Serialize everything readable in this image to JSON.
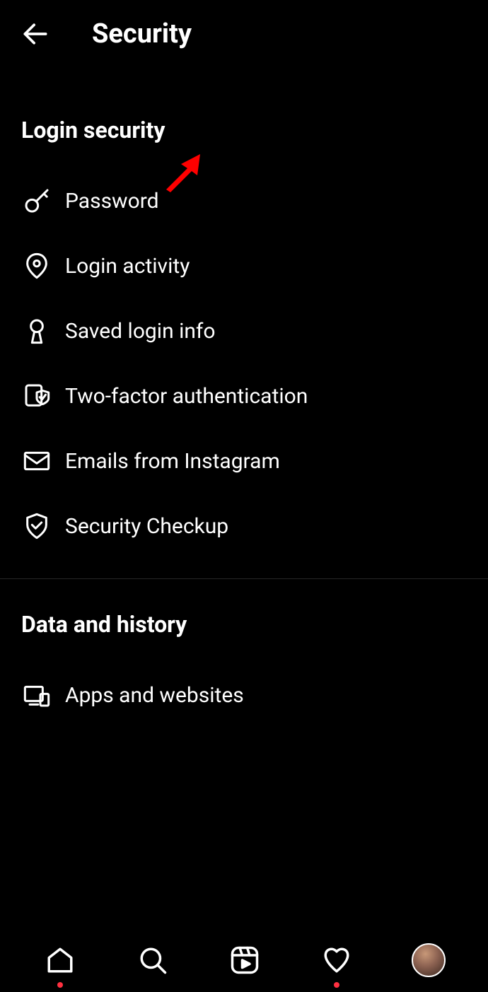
{
  "header": {
    "title": "Security"
  },
  "sections": {
    "login_security": {
      "title": "Login security",
      "items": [
        {
          "icon": "key-icon",
          "label": "Password"
        },
        {
          "icon": "location-pin-icon",
          "label": "Login activity"
        },
        {
          "icon": "keyhole-icon",
          "label": "Saved login info"
        },
        {
          "icon": "two-factor-shield-icon",
          "label": "Two-factor authentication"
        },
        {
          "icon": "envelope-icon",
          "label": "Emails from Instagram"
        },
        {
          "icon": "shield-check-icon",
          "label": "Security Checkup"
        }
      ]
    },
    "data_history": {
      "title": "Data and history",
      "items": [
        {
          "icon": "devices-icon",
          "label": "Apps and websites"
        }
      ]
    }
  },
  "annotation": {
    "arrow_color": "#ff0000"
  },
  "navigation": {
    "home_dot": true,
    "activity_dot": true
  }
}
